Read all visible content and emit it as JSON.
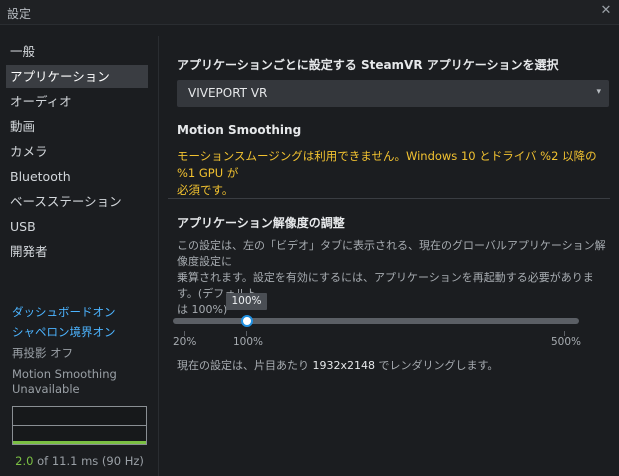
{
  "window": {
    "title": "設定",
    "close_glyph": "✕"
  },
  "sidebar": {
    "items": [
      {
        "label": "一般",
        "active": false
      },
      {
        "label": "アプリケーション",
        "active": true
      },
      {
        "label": "オーディオ",
        "active": false
      },
      {
        "label": "動画",
        "active": false
      },
      {
        "label": "カメラ",
        "active": false
      },
      {
        "label": "Bluetooth",
        "active": false
      },
      {
        "label": "ベースステーション",
        "active": false
      },
      {
        "label": "USB",
        "active": false
      },
      {
        "label": "開発者",
        "active": false
      }
    ],
    "status": {
      "dashboard": "ダッシュボードオン",
      "chaperone": "シャペロン境界オン",
      "reprojection": "再投影 オフ",
      "motion_smoothing_line1": "Motion Smoothing",
      "motion_smoothing_line2": "Unavailable"
    },
    "performance": {
      "frame_time": "2.0",
      "rest": " of 11.1 ms (90 Hz)",
      "bar_fraction": 0.18
    }
  },
  "main": {
    "select_app_title": "アプリケーションごとに設定する SteamVR アプリケーションを選択",
    "selected_app": "VIVEPORT VR",
    "dropdown_caret": "▾",
    "motion_smoothing_title": "Motion Smoothing",
    "motion_smoothing_warning_line1": "モーションスムージングは利用できません。Windows 10 とドライバ %2 以降の %1 GPU が",
    "motion_smoothing_warning_line2": "必須です。",
    "resolution_title": "アプリケーション解像度の調整",
    "resolution_desc_line1": "この設定は、左の「ビデオ」タブに表示される、現在のグローバルアプリケーション解像度設定に",
    "resolution_desc_line2": "乗算されます。設定を有効にするには、アプリケーションを再起動する必要があります。(デフォルト",
    "resolution_desc_line3": "は 100%)",
    "slider": {
      "value": 100,
      "min": 20,
      "max": 500,
      "tooltip": "100%",
      "tick_min_label": "20%",
      "tick_default_label": "100%",
      "tick_max_label": "500%"
    },
    "render_prefix": "現在の設定は、片目あたり ",
    "render_resolution": "1932x2148",
    "render_suffix": " でレンダリングします。"
  }
}
